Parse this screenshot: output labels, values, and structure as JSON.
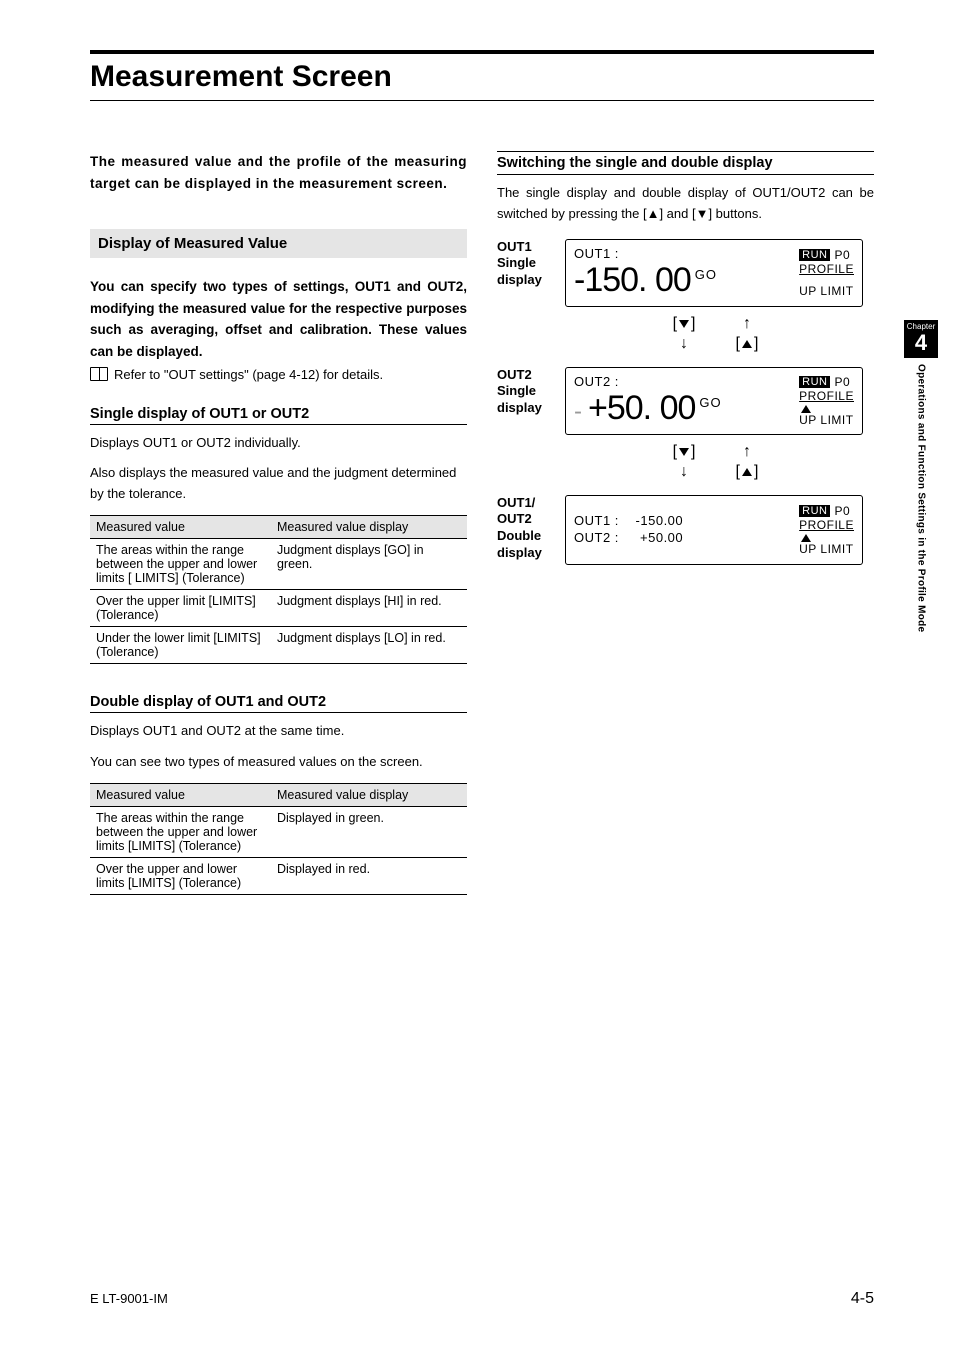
{
  "title": "Measurement Screen",
  "intro": "The measured value and the profile of the measuring target can be displayed in the measurement screen.",
  "section1_head": "Display of Measured Value",
  "section1_bold": "You can specify two types of settings, OUT1 and OUT2, modifying the measured value for the respective purposes such as averaging, offset and calibration. These values can be displayed.",
  "section1_ref": "Refer to \"OUT settings\" (page 4-12) for details.",
  "single_head": "Single display of OUT1 or OUT2",
  "single_l1": "Displays OUT1 or OUT2 individually.",
  "single_l2": "Also displays the measured value and the judgment determined by the tolerance.",
  "thead_a": "Measured value",
  "thead_b": "Measured value display",
  "t1": [
    {
      "a": "The areas within the range between the upper and lower limits [ LIMITS] (Tolerance)",
      "b": "Judgment displays [GO] in green."
    },
    {
      "a": "Over the upper limit [LIMITS] (Tolerance)",
      "b": "Judgment displays [HI] in red."
    },
    {
      "a": "Under the lower limit [LIMITS] (Tolerance)",
      "b": "Judgment displays [LO] in red."
    }
  ],
  "double_head": "Double display of OUT1 and OUT2",
  "double_l1": "Displays OUT1 and OUT2 at the same time.",
  "double_l2": "You can see two types of measured values on the screen.",
  "t2": [
    {
      "a": "The areas within the range between the upper and lower limits [LIMITS] (Tolerance)",
      "b": "Displayed in green."
    },
    {
      "a": "Over the upper and lower limits [LIMITS] (Tolerance)",
      "b": "Displayed in red."
    }
  ],
  "switch_head": "Switching the single and double display",
  "switch_body": "The single display and double display of OUT1/OUT2 can be switched by pressing the [▲] and [▼] buttons.",
  "disp1_label": "OUT1\nSingle\ndisplay",
  "disp2_label": "OUT2\nSingle\ndisplay",
  "disp3_label": "OUT1/\nOUT2\nDouble\ndisplay",
  "lcd_out1_label": "OUT1 :",
  "lcd_out2_label": "OUT2 :",
  "lcd_val1": "-150. 00",
  "lcd_val2": "+50. 00",
  "lcd_go": "GO",
  "lcd_run": "RUN",
  "lcd_p0": "P0",
  "lcd_profile": "PROFILE",
  "lcd_uplimit": "UP LIMIT",
  "lcd_dbl_l1a": "OUT1 :",
  "lcd_dbl_l1b": "-150.00",
  "lcd_dbl_l2a": "OUT2 :",
  "lcd_dbl_l2b": "+50.00",
  "sidebar_chapter": "Chapter",
  "sidebar_num": "4",
  "sidebar_text": "Operations and Function Settings in the Profile Mode",
  "footer_left": "E LT-9001-IM",
  "footer_right": "4-5"
}
